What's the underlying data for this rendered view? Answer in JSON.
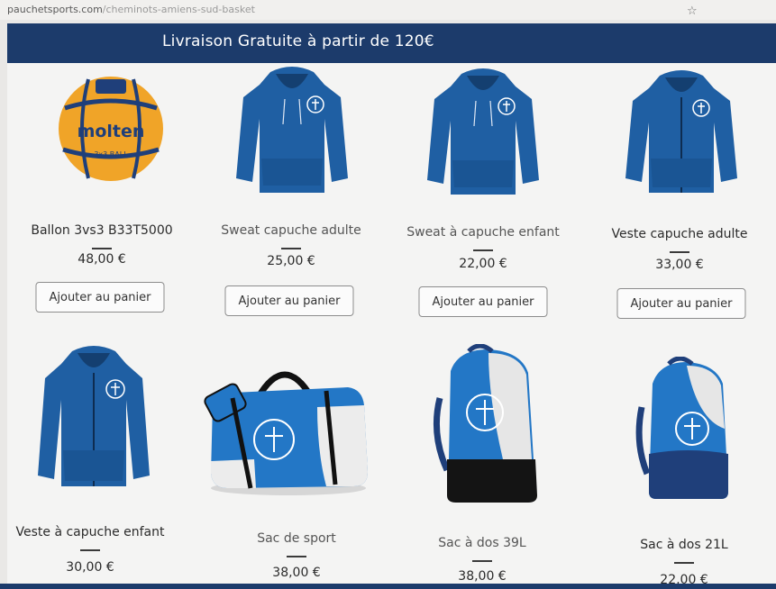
{
  "browser": {
    "url_main": "pauchetsports.com",
    "url_path": "/cheminots-amiens-sud-basket"
  },
  "banner": {
    "text": "Livraison Gratuite à partir de 120€"
  },
  "colors": {
    "banner": "#1c3b6b",
    "garment": "#1f5fa3",
    "bag_blue": "#2377c6"
  },
  "products": [
    {
      "name": "Ballon 3vs3 B33T5000",
      "price": "48,00 €",
      "button": "Ajouter au panier",
      "image": "ball-icon",
      "brand": "molten",
      "ball_text": "3x3 BALL"
    },
    {
      "name": "Sweat capuche adulte",
      "price": "25,00 €",
      "button": "Ajouter au panier",
      "image": "hoodie-icon"
    },
    {
      "name": "Sweat à capuche enfant",
      "price": "22,00 €",
      "button": "Ajouter au panier",
      "image": "hoodie-icon"
    },
    {
      "name": "Veste capuche adulte",
      "price": "33,00 €",
      "button": "Ajouter au panier",
      "image": "zip-hoodie-icon"
    },
    {
      "name": "Veste à capuche enfant",
      "price": "30,00 €",
      "image": "zip-hoodie-icon"
    },
    {
      "name": "Sac de sport",
      "price": "38,00 €",
      "image": "sport-bag-icon"
    },
    {
      "name": "Sac à dos 39L",
      "price": "38,00 €",
      "image": "backpack-icon"
    },
    {
      "name": "Sac à dos 21L",
      "price": "22,00 €",
      "image": "backpack-icon"
    }
  ]
}
